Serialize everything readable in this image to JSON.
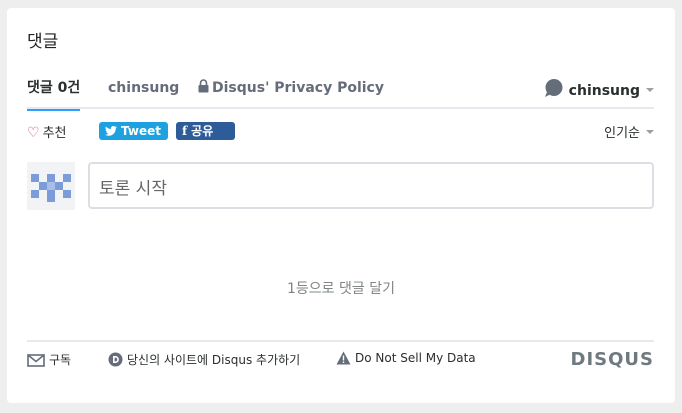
{
  "section_title": "댓글",
  "nav": {
    "comments_tab": "댓글 0건",
    "community_tab": "chinsung",
    "privacy_tab": "Disqus' Privacy Policy",
    "user_name": "chinsung"
  },
  "actions": {
    "recommend": "추천",
    "tweet": "Tweet",
    "facebook_share": "공유",
    "sort": "인기순"
  },
  "editor": {
    "placeholder": "토론 시작"
  },
  "empty_message": "1등으로 댓글 달기",
  "footer": {
    "subscribe": "구독",
    "add_disqus": "당신의 사이트에 Disqus 추가하기",
    "do_not_sell": "Do Not Sell My Data",
    "brand": "DISQUS"
  },
  "colors": {
    "accent_tab": "#2e9fff",
    "twitter": "#1da1e0",
    "facebook": "#2e5c99",
    "heart": "#e0455b",
    "avatar_pattern": "#7b9cd8"
  },
  "icons": [
    "heart-icon",
    "twitter-icon",
    "facebook-icon",
    "lock-icon",
    "speech-bubble-icon",
    "envelope-icon",
    "disqus-logo-icon",
    "warning-icon"
  ]
}
